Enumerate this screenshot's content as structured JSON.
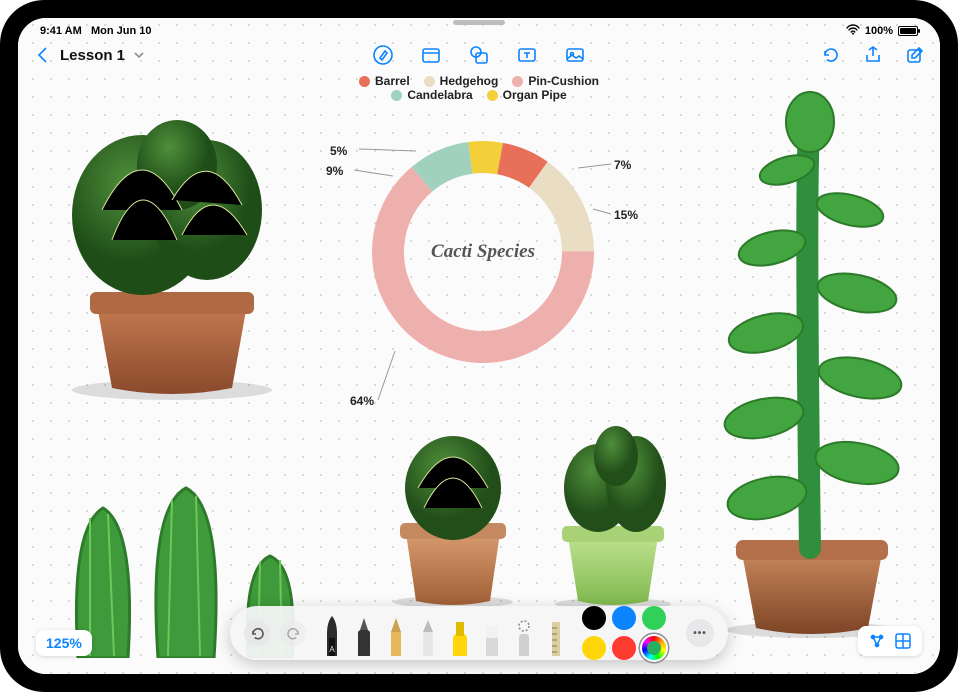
{
  "status": {
    "time": "9:41 AM",
    "date": "Mon Jun 10",
    "battery": "100%"
  },
  "header": {
    "doc_title": "Lesson 1"
  },
  "legend": {
    "items": [
      {
        "label": "Barrel",
        "color": "#e86f58"
      },
      {
        "label": "Hedgehog",
        "color": "#e9ddc3"
      },
      {
        "label": "Pin-Cushion",
        "color": "#eeb0ad"
      },
      {
        "label": "Candelabra",
        "color": "#9fd1bc"
      },
      {
        "label": "Organ Pipe",
        "color": "#f3cf3a"
      }
    ]
  },
  "chart_data": {
    "type": "pie",
    "title": "Cacti Species",
    "series": [
      {
        "name": "Candelabra",
        "value": 9,
        "color": "#9fd1bc"
      },
      {
        "name": "Organ Pipe",
        "value": 5,
        "color": "#f3cf3a"
      },
      {
        "name": "Barrel",
        "value": 7,
        "color": "#e86f58"
      },
      {
        "name": "Hedgehog",
        "value": 15,
        "color": "#e9ddc3"
      },
      {
        "name": "Pin-Cushion",
        "value": 64,
        "color": "#eeb0ad"
      }
    ],
    "labels": {
      "l5": "5%",
      "l9": "9%",
      "l7": "7%",
      "l15": "15%",
      "l64": "64%"
    }
  },
  "zoom": "125%",
  "tray": {
    "colors": [
      "#000000",
      "#0a84ff",
      "#30d158",
      "#ffd60a",
      "#ff3b30"
    ]
  }
}
